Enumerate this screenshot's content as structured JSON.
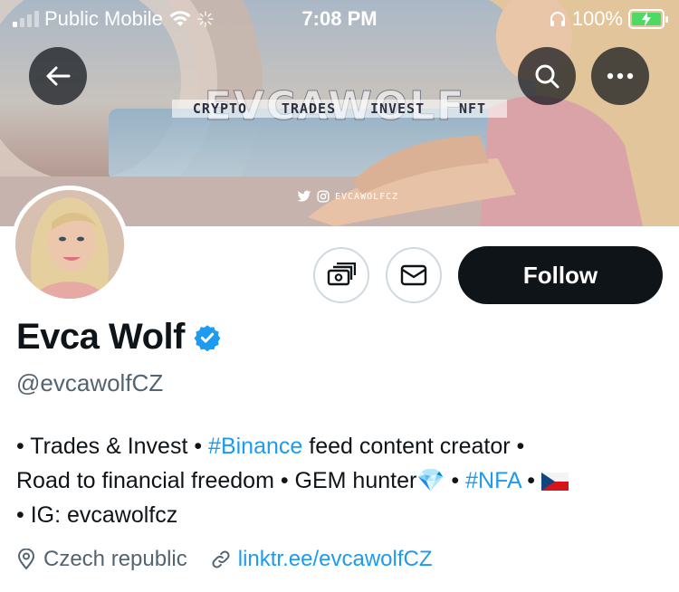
{
  "status_bar": {
    "carrier": "Public Mobile",
    "time": "7:08 PM",
    "battery": "100%",
    "signal_bars_active": 1,
    "signal_bars_total": 4
  },
  "banner": {
    "title": "EVCAWOLF",
    "subtitle_items": [
      "CRYPTO",
      "TRADES",
      "INVEST",
      "NFT"
    ],
    "social_handle": "EVCAWOLFCZ"
  },
  "actions": {
    "follow_label": "Follow"
  },
  "profile": {
    "name": "Evca Wolf",
    "handle": "@evcawolfCZ",
    "verified": true,
    "bio": {
      "line1_a": "• Trades & Invest • ",
      "line1_tag": "#Binance",
      "line1_b": " feed content creator •",
      "line2_a": "Road to financial freedom • GEM hunter",
      "line2_emoji": "💎",
      "line2_b": " • ",
      "line2_tag": "#NFA",
      "line2_c": " • ",
      "line3": "• IG: evcawolfcz"
    },
    "location": "Czech republic",
    "website": "linktr.ee/evcawolfCZ"
  },
  "colors": {
    "accent": "#1d9bf0",
    "text": "#0f1419",
    "muted": "#536471",
    "follow_bg": "#0f1419"
  },
  "icons": [
    "back-arrow-icon",
    "search-icon",
    "more-icon",
    "tip-jar-icon",
    "mail-icon",
    "verified-badge-icon",
    "location-pin-icon",
    "link-icon",
    "wifi-icon",
    "headphones-icon",
    "battery-icon",
    "twitter-icon",
    "instagram-icon",
    "czech-flag-icon",
    "diamond-icon"
  ]
}
